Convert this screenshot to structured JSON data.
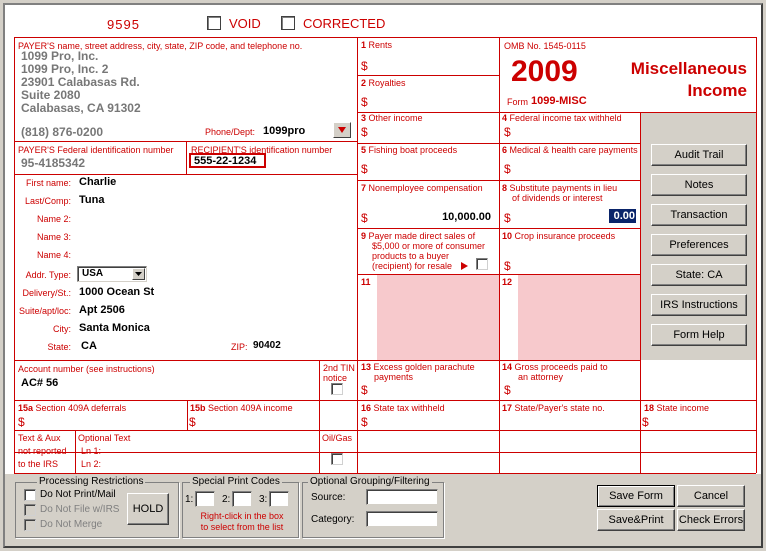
{
  "header": {
    "control_number": "9595",
    "void_label": "VOID",
    "corrected_label": "CORRECTED"
  },
  "payer": {
    "label": "PAYER'S name, street address, city, state, ZIP code, and telephone no.",
    "lines": [
      "1099 Pro, Inc.",
      "1099 Pro, Inc. 2",
      "23901 Calabasas Rd.",
      "Suite 2080",
      "Calabasas, CA 91302"
    ],
    "phone": "(818) 876-0200",
    "phone_dept_label": "Phone/Dept:",
    "phone_dept_value": "1099pro",
    "fed_id_label": "PAYER'S Federal identification number",
    "fed_id": "95-4185342"
  },
  "recipient": {
    "id_label": "RECIPIENT'S identification number",
    "id": "555-22-1234",
    "first_name_label": "First name:",
    "first_name": "Charlie",
    "last_name_label": "Last/Comp:",
    "last_name": "Tuna",
    "name2_label": "Name 2:",
    "name3_label": "Name 3:",
    "name4_label": "Name 4:",
    "addr_type_label": "Addr. Type:",
    "addr_type": "USA",
    "delivery_label": "Delivery/St.:",
    "delivery": "1000 Ocean St",
    "suite_label": "Suite/apt/loc:",
    "suite": "Apt 2506",
    "city_label": "City:",
    "city": "Santa Monica",
    "state_label": "State:",
    "state": "CA",
    "zip_label": "ZIP:",
    "zip": "90402"
  },
  "account": {
    "label": "Account number (see instructions)",
    "value": "AC# 56",
    "second_tin_label_1": "2nd TIN",
    "second_tin_label_2": "notice"
  },
  "form": {
    "omb": "OMB No. 1545-0115",
    "year": "2009",
    "form_prefix": "Form",
    "form_name": "1099-MISC",
    "title_1": "Miscellaneous",
    "title_2": "Income"
  },
  "boxes": {
    "b1": "Rents",
    "b2": "Royalties",
    "b3": "Other income",
    "b4": "Federal income tax withheld",
    "b5": "Fishing boat proceeds",
    "b6": "Medical & health care payments",
    "b7": "Nonemployee compensation",
    "b7_value": "10,000.00",
    "b8_1": "Substitute payments in lieu",
    "b8_2": "of dividends or interest",
    "b8_value": "0.00",
    "b9_1": "Payer made direct sales of",
    "b9_2": "$5,000 or more of consumer",
    "b9_3": "products to a buyer",
    "b9_4": "(recipient) for resale",
    "b10": "Crop insurance proceeds",
    "b11": "11",
    "b12": "12",
    "b13_1": "Excess golden parachute",
    "b13_2": "payments",
    "b14_1": "Gross proceeds paid to",
    "b14_2": "an attorney",
    "b15a": "Section 409A deferrals",
    "b15b": "Section 409A income",
    "b16": "State tax withheld",
    "b17": "State/Payer's state no.",
    "b18": "State income",
    "n1": "1",
    "n2": "2",
    "n3": "3",
    "n4": "4",
    "n5": "5",
    "n6": "6",
    "n7": "7",
    "n8": "8",
    "n9": "9",
    "n10": "10",
    "n13": "13",
    "n14": "14",
    "n15a": "15a",
    "n15b": "15b",
    "n16": "16",
    "n17": "17",
    "n18": "18",
    "dollar": "$"
  },
  "text_aux": {
    "l1": "Text & Aux",
    "l2": "not reported",
    "l3": "to the IRS",
    "optional": "Optional Text",
    "ln1": "Ln 1:",
    "ln2": "Ln 2:",
    "oilgas": "Oil/Gas"
  },
  "side_buttons": [
    "Audit Trail",
    "Notes",
    "Transaction",
    "Preferences",
    "State: CA",
    "IRS Instructions",
    "Form Help"
  ],
  "processing": {
    "title": "Processing Restrictions",
    "do_not_print": "Do Not Print/Mail",
    "do_not_file": "Do Not File w/IRS",
    "do_not_merge": "Do Not Merge",
    "hold": "HOLD"
  },
  "special_print": {
    "title": "Special Print Codes",
    "c1": "1:",
    "c2": "2:",
    "c3": "3:",
    "hint_1": "Right-click in the box",
    "hint_2": "to select from the list"
  },
  "grouping": {
    "title": "Optional Grouping/Filtering",
    "source": "Source:",
    "category": "Category:"
  },
  "actions": {
    "save_form": "Save Form",
    "cancel": "Cancel",
    "save_print": "Save&Print",
    "check_errors": "Check Errors"
  }
}
